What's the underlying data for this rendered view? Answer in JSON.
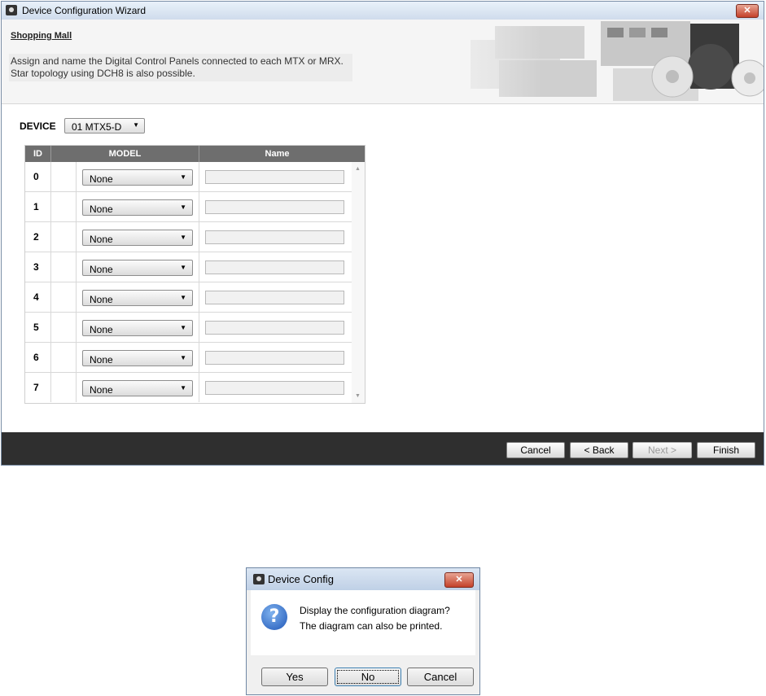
{
  "wizard": {
    "title": "Device Configuration Wizard",
    "header_title": "Shopping Mall",
    "description_line1": "Assign and name the Digital Control Panels connected to each MTX or MRX.",
    "description_line2": "Star topology using DCH8 is also possible.",
    "device_label": "DEVICE",
    "device_value": "01 MTX5-D",
    "columns": {
      "id": "ID",
      "model": "MODEL",
      "name": "Name"
    },
    "rows": [
      {
        "id": "0",
        "model": "None",
        "name": ""
      },
      {
        "id": "1",
        "model": "None",
        "name": ""
      },
      {
        "id": "2",
        "model": "None",
        "name": ""
      },
      {
        "id": "3",
        "model": "None",
        "name": ""
      },
      {
        "id": "4",
        "model": "None",
        "name": ""
      },
      {
        "id": "5",
        "model": "None",
        "name": ""
      },
      {
        "id": "6",
        "model": "None",
        "name": ""
      },
      {
        "id": "7",
        "model": "None",
        "name": ""
      }
    ],
    "buttons": {
      "cancel": "Cancel",
      "back": "< Back",
      "next": "Next >",
      "finish": "Finish"
    }
  },
  "dialog": {
    "title": "Device Config",
    "message_line1": "Display the configuration diagram?",
    "message_line2": "The diagram can also be printed.",
    "buttons": {
      "yes": "Yes",
      "no": "No",
      "cancel": "Cancel"
    }
  }
}
